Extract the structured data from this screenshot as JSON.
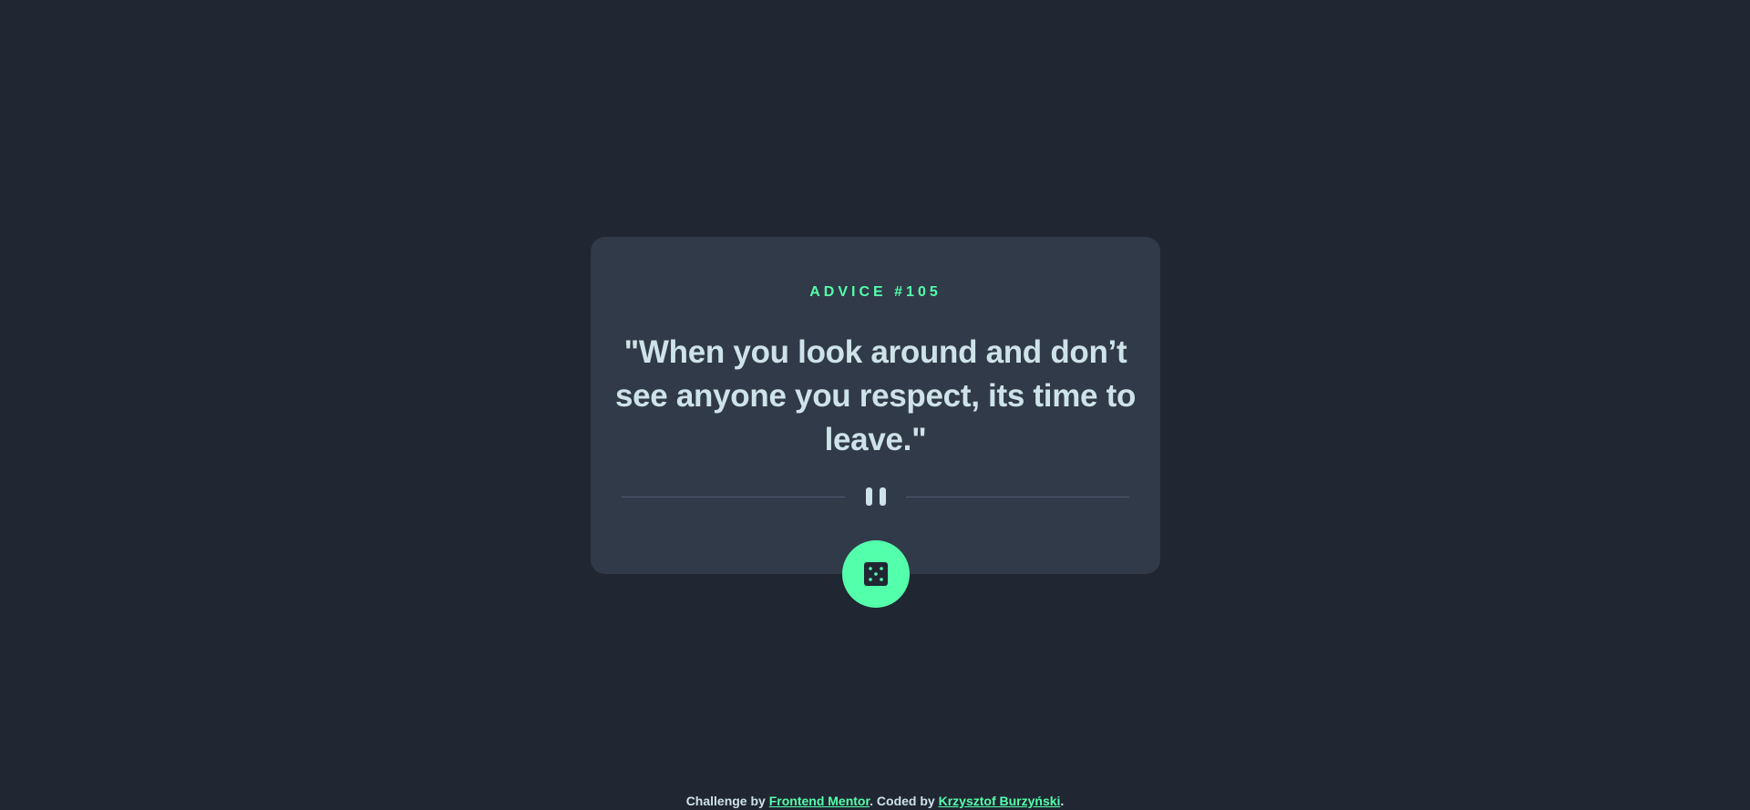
{
  "card": {
    "advice_label": "ADVICE #105",
    "quote": "\"When you look around and don’t see anyone you respect, its time to leave.\""
  },
  "icons": {
    "divider": "pause-icon",
    "button": "dice-icon"
  },
  "colors": {
    "background": "#202632",
    "card": "#313a48",
    "accent": "#53ffaa",
    "text": "#cee3e9",
    "divider": "#4f5d74"
  },
  "footer": {
    "challenge_prefix": "Challenge by ",
    "challenge_link": "Frontend Mentor",
    "coded_prefix": ". Coded by ",
    "coded_link": "Krzysztof Burzyński",
    "suffix": "."
  }
}
